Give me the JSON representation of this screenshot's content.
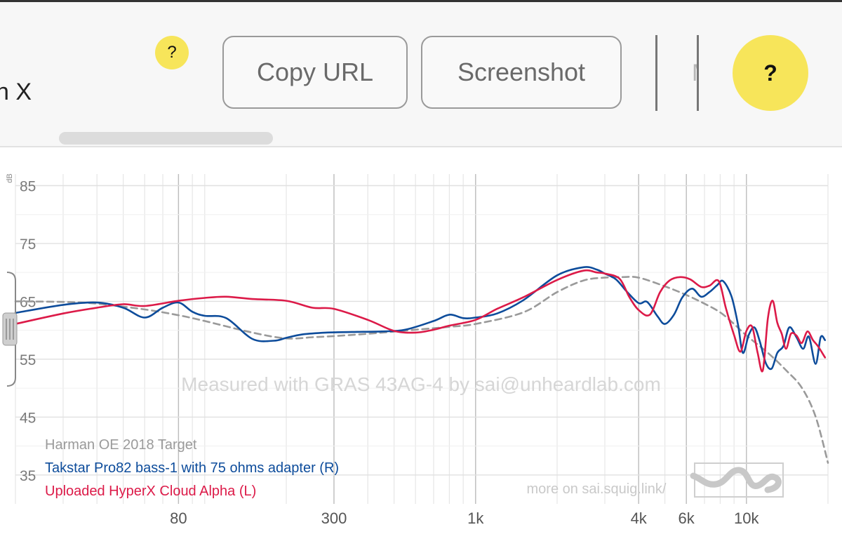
{
  "toolbar": {
    "title_fragment": "n X",
    "help_small_label": "?",
    "copy_url_label": "Copy URL",
    "screenshot_label": "Screenshot",
    "cut_off_button_label": "M",
    "help_big_label": "?"
  },
  "colors": {
    "accent": "#f7e55a",
    "target": "#9a9a9a",
    "takstar": "#0d4c9b",
    "hyperx": "#dc1a48",
    "grid": "#e6e6e6",
    "watermark": "#d6d6d6"
  },
  "chart_data": {
    "type": "line",
    "ylabel": "dB",
    "ylim": [
      30,
      87
    ],
    "xscale": "log",
    "xlim": [
      20,
      20000
    ],
    "y_ticks": [
      85,
      75,
      65,
      55,
      45,
      35
    ],
    "x_ticks": [
      {
        "value": 80,
        "label": "80"
      },
      {
        "value": 300,
        "label": "300"
      },
      {
        "value": 1000,
        "label": "1k"
      },
      {
        "value": 4000,
        "label": "4k"
      },
      {
        "value": 6000,
        "label": "6k"
      },
      {
        "value": 10000,
        "label": "10k"
      }
    ],
    "grid": true,
    "watermark": "Measured with GRAS 43AG-4 by sai@unheardlab.com",
    "footer_link": "more on sai.squig.link/",
    "legend_placement": "bottom-left",
    "series": [
      {
        "name": "Harman OE 2018 Target",
        "key": "target",
        "style": "dashed",
        "x": [
          20,
          30,
          40,
          60,
          80,
          100,
          150,
          200,
          250,
          300,
          400,
          600,
          800,
          1000,
          1500,
          2000,
          2500,
          3000,
          3500,
          4000,
          5000,
          6000,
          7000,
          8000,
          9000,
          10000,
          12000,
          14000,
          16000,
          18000,
          20000
        ],
        "y": [
          65,
          64.9,
          64.6,
          63.6,
          62.6,
          61.6,
          59.6,
          58.6,
          58.8,
          59,
          59.4,
          60.1,
          60.6,
          61.1,
          63.1,
          66.6,
          68.6,
          69.1,
          69.2,
          69.1,
          67.6,
          66.1,
          64.6,
          63.1,
          61.1,
          59.1,
          56.1,
          53.1,
          50.1,
          45.1,
          37.1
        ]
      },
      {
        "name": "Takstar Pro82 bass-1 with 75 ohms adapter (R)",
        "key": "takstar",
        "style": "solid",
        "x": [
          20,
          30,
          40,
          50,
          60,
          70,
          80,
          90,
          100,
          120,
          150,
          180,
          200,
          230,
          280,
          350,
          450,
          550,
          700,
          800,
          900,
          1000,
          1200,
          1500,
          2000,
          2500,
          2800,
          3000,
          3300,
          3600,
          4000,
          4300,
          4700,
          5000,
          5400,
          5800,
          6300,
          6800,
          7300,
          7800,
          8200,
          8800,
          9300,
          9700,
          10200,
          10700,
          11200,
          11800,
          12400,
          13000,
          13700,
          14400,
          15300,
          16200,
          17000,
          18000,
          18800,
          19500
        ],
        "y": [
          63,
          64.4,
          64.8,
          63.9,
          62.2,
          63.9,
          64.8,
          63.2,
          62.5,
          62.1,
          58.5,
          58.2,
          58.7,
          59.3,
          59.6,
          59.7,
          59.8,
          60.1,
          61.6,
          62.7,
          62.1,
          62.2,
          62.9,
          65.2,
          69.5,
          70.9,
          70.5,
          69.8,
          68.8,
          66.8,
          64.7,
          64.9,
          62.4,
          61.1,
          62.7,
          65.7,
          67.2,
          65.8,
          66.6,
          67.8,
          68.5,
          65.9,
          61.1,
          56.1,
          59.2,
          60.5,
          58.1,
          54.3,
          53.4,
          56.1,
          57.3,
          60.5,
          58.8,
          56.8,
          58.9,
          54.2,
          58.8,
          58.3
        ]
      },
      {
        "name": "Uploaded HyperX Cloud Alpha (L)",
        "key": "hyperx",
        "style": "solid",
        "x": [
          20,
          30,
          40,
          50,
          60,
          80,
          100,
          120,
          150,
          200,
          250,
          300,
          400,
          500,
          600,
          700,
          800,
          1000,
          1200,
          1500,
          2000,
          2500,
          2800,
          3000,
          3400,
          3700,
          4000,
          4400,
          4800,
          5200,
          5700,
          6200,
          6800,
          7300,
          7900,
          8400,
          9000,
          9500,
          10000,
          10500,
          11000,
          11500,
          12000,
          12500,
          13000,
          13500,
          14000,
          14600,
          15300,
          16000,
          16800,
          17600,
          18400,
          19500
        ],
        "y": [
          61.1,
          62.9,
          63.9,
          64.5,
          64.2,
          65.1,
          65.6,
          65.8,
          65.4,
          65.1,
          63.9,
          63.7,
          61.8,
          59.9,
          59.6,
          60.1,
          60.8,
          61.8,
          63.7,
          65.7,
          68.7,
          70.3,
          70,
          69.8,
          68.9,
          65.7,
          63.5,
          62.7,
          66.6,
          68.6,
          69.2,
          68.8,
          67.5,
          67.7,
          68.5,
          63.8,
          59.2,
          56.3,
          59.9,
          60.6,
          56.1,
          53.1,
          62.1,
          65.1,
          61.3,
          59.4,
          56.8,
          59.4,
          59.1,
          57.8,
          59.8,
          58.3,
          57.2,
          55.3
        ]
      }
    ]
  }
}
